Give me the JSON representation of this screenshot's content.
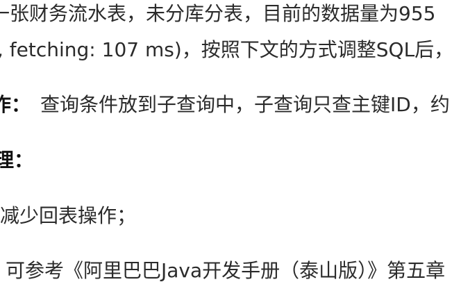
{
  "document": {
    "line1": "一张财务流水表，未分库分表，目前的数据量为955",
    "line2": ", fetching: 107 ms)，按照下文的方式调整SQL后，",
    "line3_label": "作：",
    "line3_text": "查询条件放到子查询中，子查询只查主键ID，约",
    "line4_label": "理：",
    "line5": "减少回表操作；",
    "line6": "可参考《阿里巴巴Java开发手册（泰山版）》第五章"
  }
}
